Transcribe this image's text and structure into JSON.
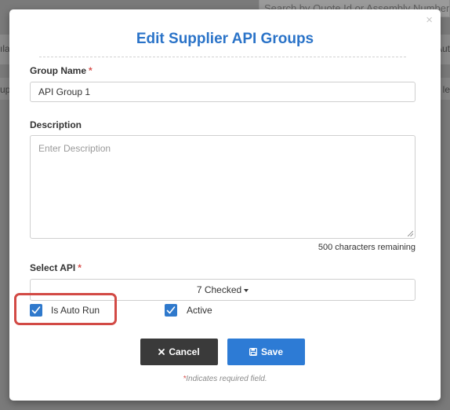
{
  "background": {
    "search_placeholder": "Search by Quote Id or Assembly Number...",
    "left_fragment_1": "ıla",
    "left_fragment_2": "up",
    "right_fragment_1": "Aut",
    "right_fragment_2": "le"
  },
  "modal": {
    "title": "Edit Supplier API Groups",
    "close_glyph": "×",
    "group_name": {
      "label": "Group Name",
      "required_mark": "*",
      "value": "API Group 1"
    },
    "description": {
      "label": "Description",
      "placeholder": "Enter Description",
      "chars_remaining": "500 characters remaining"
    },
    "select_api": {
      "label": "Select API",
      "required_mark": "*",
      "selected_text": "7 Checked"
    },
    "checkboxes": [
      {
        "label": "Is Auto Run",
        "checked": true
      },
      {
        "label": "Active",
        "checked": true
      }
    ],
    "buttons": {
      "cancel_label": "Cancel",
      "save_label": "Save"
    },
    "footnote": {
      "star": "*",
      "text": "Indicates required field."
    }
  },
  "colors": {
    "title": "#2a73c8",
    "checkbox": "#2f79cc",
    "save_button": "#2d7bd5",
    "cancel_button": "#3a3a3a",
    "highlight": "#d24a45",
    "required": "#d9534f"
  },
  "icons": {
    "close": "close-icon",
    "caret": "caret-down-icon",
    "check": "check-icon",
    "cancel": "x-icon",
    "save": "floppy-disk-icon"
  }
}
